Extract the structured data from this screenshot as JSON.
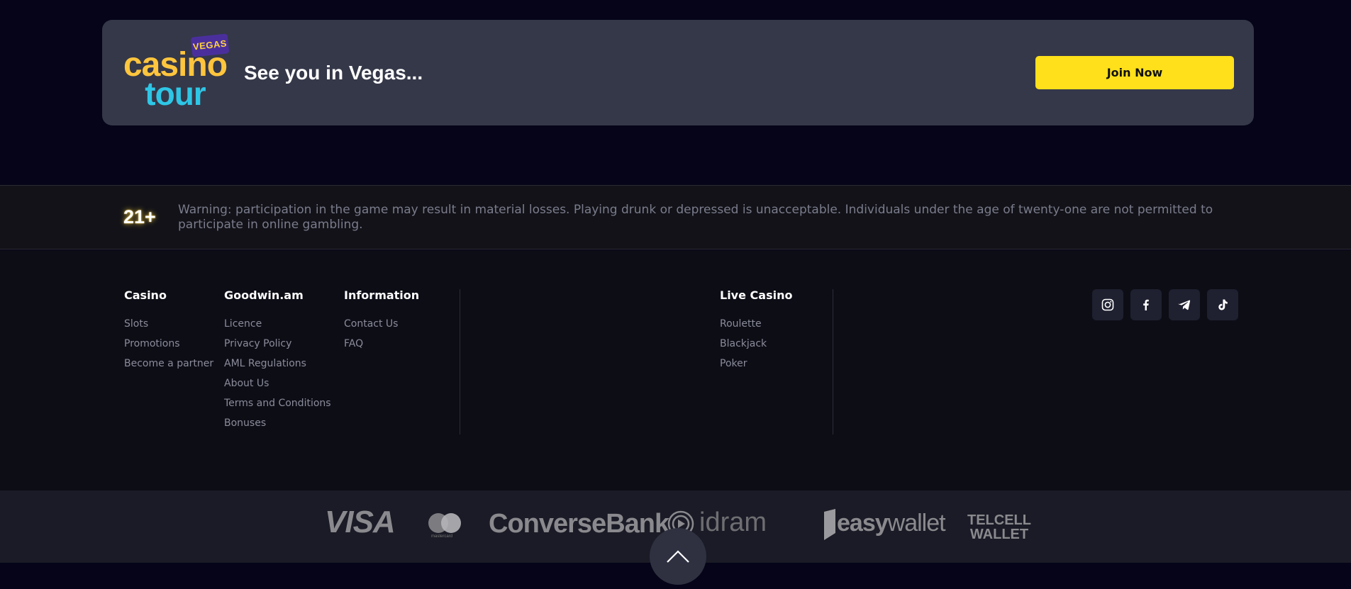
{
  "banner": {
    "logo_badge": "VEGAS",
    "logo_line1": "casino",
    "logo_line2": "tour",
    "title": "See you in Vegas...",
    "cta_label": "Join Now"
  },
  "warning": {
    "age_label": "21+",
    "text": "Warning: participation in the game may result in material losses. Playing drunk or depressed is unacceptable. Individuals under the age of twenty-one are not permitted to participate in online gambling."
  },
  "footer": {
    "columns": [
      {
        "title": "Casino",
        "links": [
          "Slots",
          "Promotions",
          "Become a partner"
        ]
      },
      {
        "title": "Goodwin.am",
        "links": [
          "Licence",
          "Privacy Policy",
          "AML Regulations",
          "About Us",
          "Terms and Conditions",
          "Bonuses"
        ]
      },
      {
        "title": "Information",
        "links": [
          "Contact Us",
          "FAQ"
        ]
      },
      {
        "title": "Live Casino",
        "links": [
          "Roulette",
          "Blackjack",
          "Poker"
        ]
      }
    ],
    "socials": [
      "instagram-icon",
      "facebook-icon",
      "telegram-icon",
      "tiktok-icon"
    ]
  },
  "payments": {
    "visa": "VISA",
    "mastercard_label": "mastercard",
    "conversebank": "ConverseBank",
    "idram": "idram",
    "easywallet_bold": "easy",
    "easywallet_thin": "wallet",
    "telcell_line1": "TELCELL",
    "telcell_line2": "WALLET"
  },
  "colors": {
    "accent_yellow": "#ffe01a",
    "logo_yellow": "#ffc53d",
    "logo_cyan": "#2ec6e6",
    "page_bg": "#050418",
    "banner_bg": "#353849"
  }
}
